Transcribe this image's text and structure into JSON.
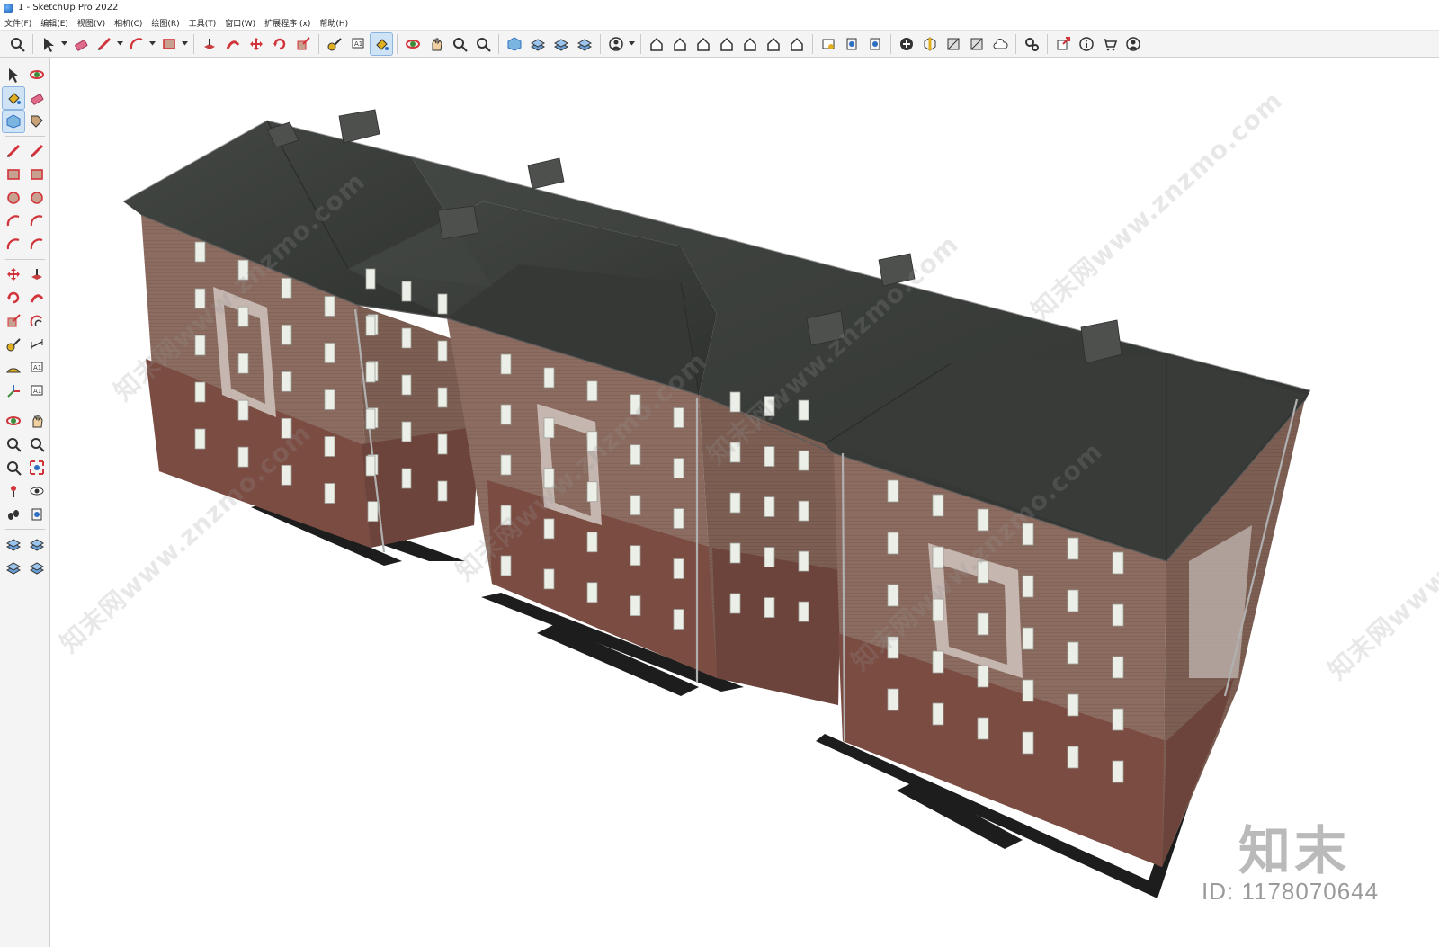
{
  "window": {
    "title": "1 - SketchUp Pro 2022"
  },
  "menu": [
    "文件(F)",
    "编辑(E)",
    "视图(V)",
    "相机(C)",
    "绘图(R)",
    "工具(T)",
    "窗口(W)",
    "扩展程序 (x)",
    "帮助(H)"
  ],
  "toolbar": {
    "groups": [
      [
        "zoom-icon"
      ],
      [
        "select-icon",
        "eraser-icon",
        "pencil-icon",
        "arc-icon",
        "rectangle-icon"
      ],
      [
        "push-pull-icon",
        "follow-me-icon",
        "move-icon",
        "rotate-icon",
        "scale-icon"
      ],
      [
        "tape-measure-icon",
        "text-icon",
        "paint-bucket-icon"
      ],
      [
        "orbit-icon",
        "pan-icon",
        "zoom-window-icon",
        "zoom-extents-icon"
      ],
      [
        "warehouse-icon",
        "sandbox-icon",
        "layers-icon",
        "solid-tools-icon"
      ],
      [
        "account-icon"
      ],
      [
        "iso-view-icon",
        "top-view-icon",
        "front-view-icon",
        "right-view-icon",
        "back-view-icon",
        "left-view-icon",
        "bottom-view-icon"
      ],
      [
        "style-xray-icon",
        "section-plane-icon",
        "section-display-icon"
      ],
      [
        "add-location-icon",
        "shadows-icon",
        "fog-icon",
        "match-photo-icon",
        "cloud-icon"
      ],
      [
        "extension-manager-icon"
      ],
      [
        "share-model-icon",
        "info-icon",
        "store-icon",
        "profile-icon"
      ]
    ]
  },
  "left_toolbar": {
    "rows": [
      [
        "select-icon",
        "orbit-lasso-icon"
      ],
      [
        "paint-bucket-icon",
        "eraser-icon"
      ],
      [
        "component-icon",
        "tag-tool-icon"
      ],
      [
        "pencil-icon",
        "freehand-icon"
      ],
      [
        "rectangle-icon",
        "rotated-rectangle-icon"
      ],
      [
        "circle-icon",
        "polygon-icon"
      ],
      [
        "arc-icon",
        "arc-2pt-icon"
      ],
      [
        "arc-3pt-icon",
        "pie-icon"
      ],
      [
        "move-icon",
        "push-pull-icon"
      ],
      [
        "rotate-icon",
        "follow-me-icon"
      ],
      [
        "scale-icon",
        "offset-icon"
      ],
      [
        "tape-measure-icon",
        "dimension-icon"
      ],
      [
        "protractor-icon",
        "text-icon"
      ],
      [
        "axes-icon",
        "3d-text-icon"
      ],
      [
        "orbit-icon",
        "pan-icon"
      ],
      [
        "zoom-icon",
        "zoom-window-icon"
      ],
      [
        "zoom-extents-icon",
        "previous-view-icon"
      ],
      [
        "position-camera-icon",
        "look-around-icon"
      ],
      [
        "walk-icon",
        "section-plane-icon"
      ],
      [
        "sandbox-from-contours-icon",
        "sandbox-scratch-icon"
      ],
      [
        "sandbox-smoove-icon",
        "sandbox-stamp-icon"
      ]
    ]
  },
  "viewport": {
    "watermark_text": "知末网www.znzmo.com",
    "brand_logo": "知末",
    "model_id": "ID: 1178070644"
  },
  "colors": {
    "roof": "#3a3d3a",
    "brick_upper": "#8a6a5e",
    "brick_lower": "#7a4f44",
    "trim": "#c8bdb8",
    "shadow": "#1e1e1e",
    "active_tool": "#cfe3f7"
  }
}
